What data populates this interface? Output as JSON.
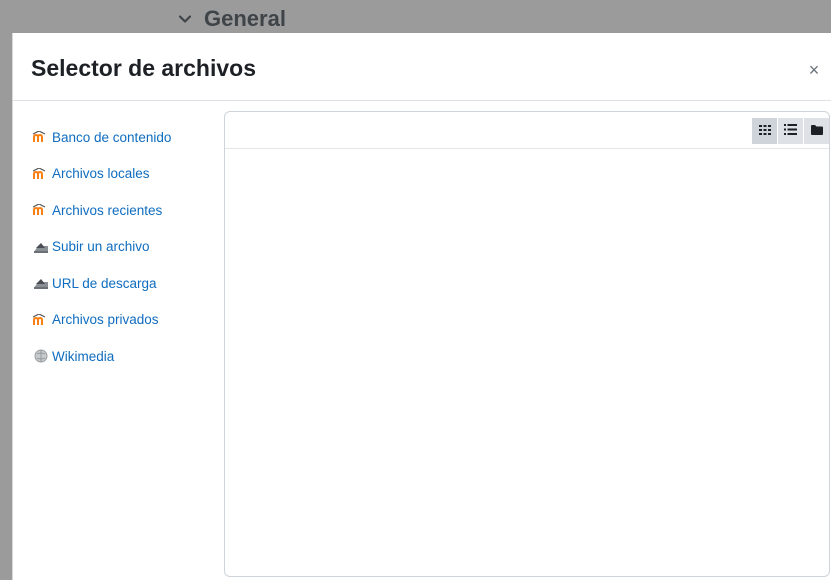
{
  "background": {
    "section_title": "General",
    "section_icon": "chevron-down-icon"
  },
  "dialog": {
    "title": "Selector de archivos",
    "close_label": "×"
  },
  "repositories": [
    {
      "label": "Banco de contenido",
      "icon": "moodle-icon"
    },
    {
      "label": "Archivos locales",
      "icon": "moodle-icon"
    },
    {
      "label": "Archivos recientes",
      "icon": "moodle-icon"
    },
    {
      "label": "Subir un archivo",
      "icon": "upload-icon"
    },
    {
      "label": "URL de descarga",
      "icon": "upload-icon"
    },
    {
      "label": "Archivos privados",
      "icon": "moodle-icon"
    },
    {
      "label": "Wikimedia",
      "icon": "wikimedia-icon"
    }
  ],
  "view_modes": [
    {
      "name": "icons-view",
      "icon": "grid-icon"
    },
    {
      "name": "list-view",
      "icon": "list-icon"
    },
    {
      "name": "tree-view",
      "icon": "folder-icon"
    }
  ],
  "colors": {
    "link": "#0f6cbf",
    "moodle_orange": "#f98012"
  }
}
